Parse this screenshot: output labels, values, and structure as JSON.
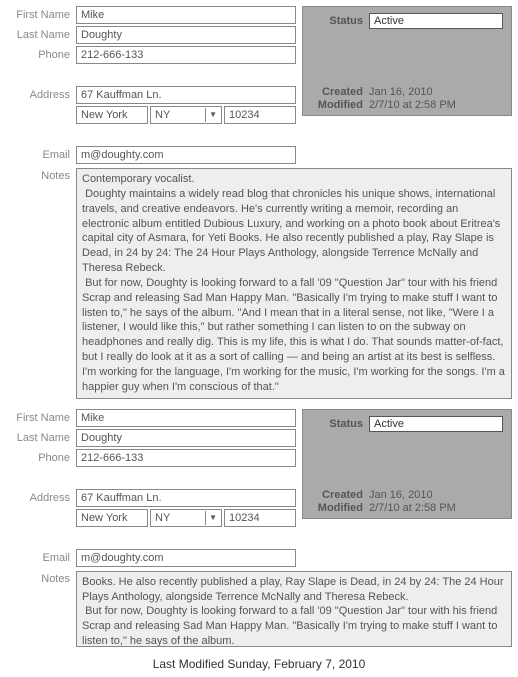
{
  "labels": {
    "first_name": "First Name",
    "last_name": "Last Name",
    "phone": "Phone",
    "address": "Address",
    "email": "Email",
    "notes": "Notes",
    "status": "Status",
    "created": "Created",
    "modified": "Modified"
  },
  "record": {
    "first_name": "Mike",
    "last_name": "Doughty",
    "phone": "212-666-133",
    "address1": "67 Kauffman Ln.",
    "city": "New York",
    "state": "NY",
    "zip": "10234",
    "email": "m@doughty.com",
    "status": "Active",
    "created": "Jan 16, 2010",
    "modified": "2/7/10 at 2:58 PM"
  },
  "notes_full": "Contemporary vocalist.\n Doughty maintains a widely read blog that chronicles his unique shows, international travels, and creative endeavors. He's currently writing a memoir, recording an electronic album entitled Dubious Luxury, and working on a photo book about Eritrea's capital city of Asmara, for Yeti Books. He also recently published a play, Ray Slape is Dead, in 24 by 24: The 24 Hour Plays Anthology, alongside Terrence McNally and Theresa Rebeck.\n But for now, Doughty is looking forward to a fall '09 \"Question Jar\" tour with his friend Scrap and releasing Sad Man Happy Man. \"Basically I'm trying to make stuff I want to listen to,\" he says of the album. \"And I mean that in a literal sense, not like, \"Were I a listener, I would like this,\" but rather something I can listen to on the subway on headphones and really dig. This is my life, this is what I do. That sounds matter-of-fact, but I really do look at it as a sort of calling — and being an artist at its best is selfless. I'm working for the language, I'm working for the music, I'm working for the songs. I'm a happier guy when I'm conscious of that.\"",
  "notes_scroll": "Books. He also recently published a play, Ray Slape is Dead, in 24 by 24: The 24 Hour Plays Anthology, alongside Terrence McNally and Theresa Rebeck.\n But for now, Doughty is looking forward to a fall '09 \"Question Jar\" tour with his friend Scrap and releasing Sad Man Happy Man. \"Basically I'm trying to make stuff I want to listen to,\" he says of the album.",
  "footer": "Last Modified Sunday, February 7, 2010"
}
